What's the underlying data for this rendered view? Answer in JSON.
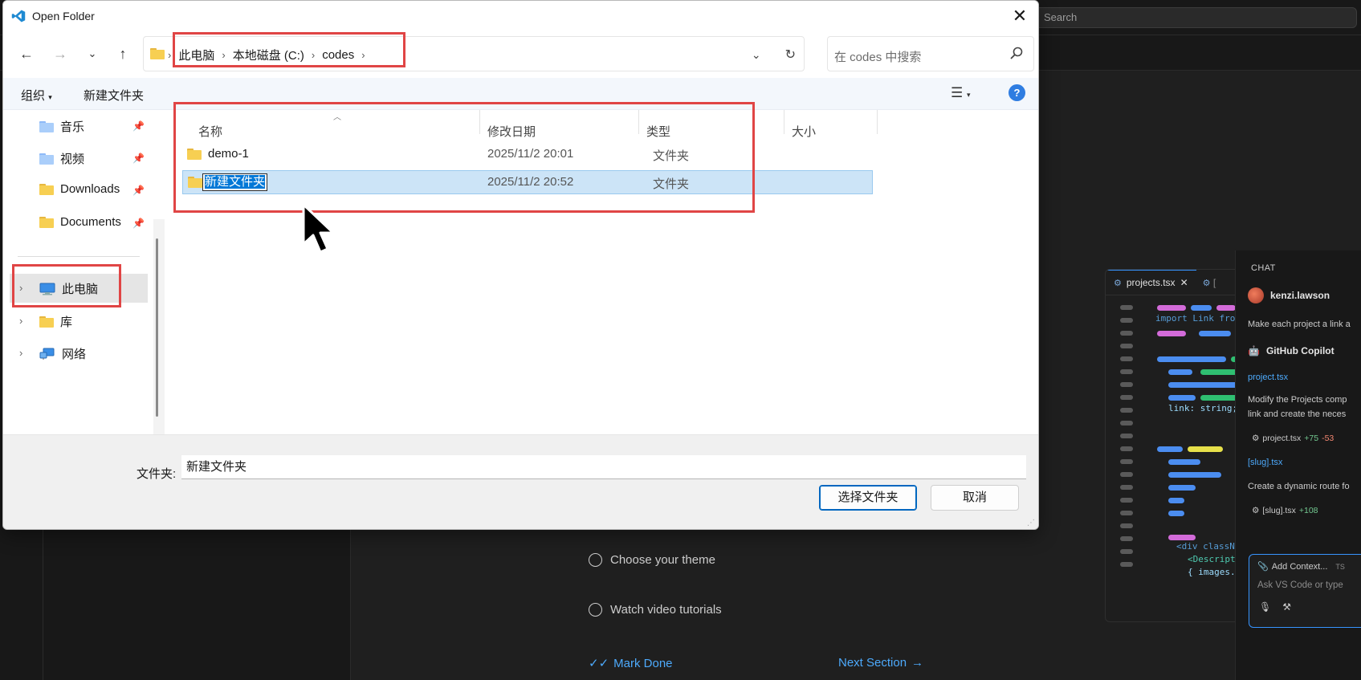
{
  "background": {
    "search_placeholder": "Search",
    "walkthrough": {
      "items": [
        "Choose your theme",
        "Watch video tutorials"
      ],
      "mark_done": "Mark Done",
      "next_section": "Next Section"
    },
    "preview": {
      "tab_active": "projects.tsx",
      "tab_other": "[",
      "code_import": "import Link fro",
      "code_link": "link: string;",
      "code_div": "<div classN",
      "code_desc": "<Descript",
      "code_images": "{ images."
    },
    "chat": {
      "title": "CHAT",
      "user": "kenzi.lawson",
      "user_message": "Make each project a link a",
      "assistant": "GitHub Copilot",
      "file1_link": "project.tsx",
      "response1_line1": "Modify the Projects comp",
      "response1_line2": "link and create the neces",
      "file1_name": "project.tsx",
      "file1_plus": "+75",
      "file1_minus": "-53",
      "file2_link": "[slug].tsx",
      "response2": "Create a dynamic route fo",
      "file2_name": "[slug].tsx",
      "file2_plus": "+108",
      "add_context": "Add Context...",
      "lang_badge": "TS",
      "input_placeholder": "Ask VS Code or type"
    }
  },
  "dialog": {
    "title": "Open Folder",
    "breadcrumbs": [
      "此电脑",
      "本地磁盘 (C:)",
      "codes"
    ],
    "search_placeholder": "在 codes 中搜索",
    "toolbar": {
      "organize": "组织",
      "new_folder": "新建文件夹"
    },
    "nav_items": {
      "pinned": [
        {
          "label": "音乐",
          "icon": "music-folder-icon"
        },
        {
          "label": "视频",
          "icon": "video-folder-icon"
        },
        {
          "label": "Downloads",
          "icon": "folder-icon"
        },
        {
          "label": "Documents",
          "icon": "folder-icon"
        }
      ],
      "tree": [
        {
          "label": "此电脑",
          "icon": "computer-icon",
          "selected": true
        },
        {
          "label": "库",
          "icon": "library-icon"
        },
        {
          "label": "网络",
          "icon": "network-icon"
        }
      ]
    },
    "columns": [
      "名称",
      "修改日期",
      "类型",
      "大小"
    ],
    "rows": [
      {
        "name": "demo-1",
        "modified": "2025/11/2 20:01",
        "type": "文件夹",
        "size": ""
      },
      {
        "name": "新建文件夹",
        "modified": "2025/11/2 20:52",
        "type": "文件夹",
        "size": "",
        "selected": true,
        "renaming": true
      }
    ],
    "folder_label": "文件夹:",
    "folder_value": "新建文件夹",
    "select_button": "选择文件夹",
    "cancel_button": "取消"
  },
  "colors": {
    "accent_blue": "#0078d7",
    "annotation_red": "#e04545",
    "vscode_bg": "#1f1f1f"
  }
}
